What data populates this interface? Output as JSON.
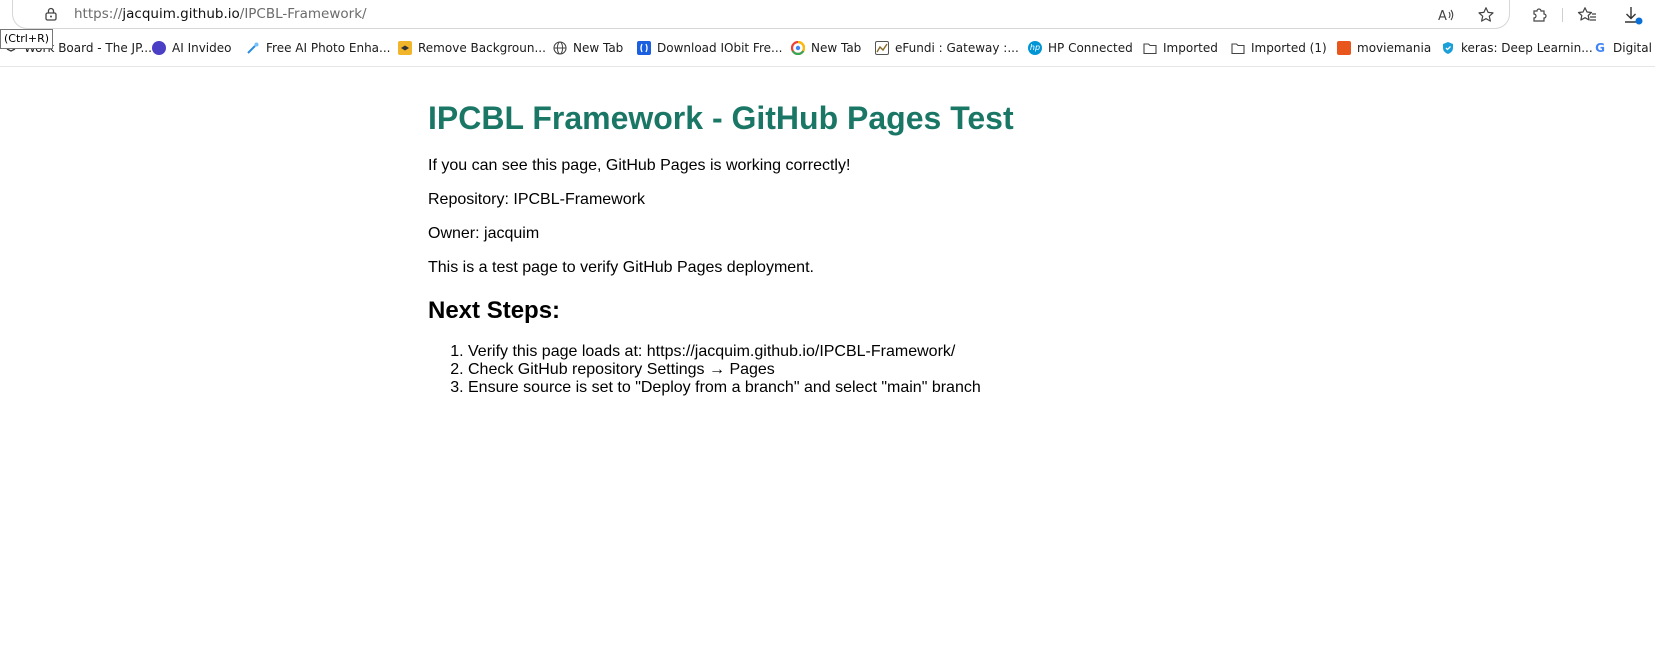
{
  "browser": {
    "url_scheme": "https://",
    "url_host": "jacquim.github.io",
    "url_path": "/IPCBL-Framework/",
    "tooltip": "(Ctrl+R)",
    "toolbar_icons": [
      "read-aloud-icon",
      "favorite-star-icon",
      "extensions-icon",
      "favorites-icon",
      "downloads-icon"
    ]
  },
  "bookmarks": [
    {
      "label": "Work Board - The JP...",
      "icon": "work-board-icon",
      "color": "#3a3a3a"
    },
    {
      "label": "AI Invideo",
      "icon": "invideo-icon",
      "color": "#4b3fc6"
    },
    {
      "label": "Free AI Photo Enha...",
      "icon": "photo-enhance-icon",
      "color": "#2a8be0"
    },
    {
      "label": "Remove Backgroun...",
      "icon": "remove-bg-icon",
      "color": "#f1b52c"
    },
    {
      "label": "New Tab",
      "icon": "globe-icon",
      "color": "#444444"
    },
    {
      "label": "Download IObit Fre...",
      "icon": "iobit-icon",
      "color": "#1a5fe0"
    },
    {
      "label": "New Tab",
      "icon": "chrome-icon",
      "color": "#34a853"
    },
    {
      "label": "eFundi : Gateway :...",
      "icon": "efundi-icon",
      "color": "#8a6a2a"
    },
    {
      "label": "HP Connected",
      "icon": "hp-icon",
      "color": "#0096d6"
    },
    {
      "label": "Imported",
      "icon": "folder-icon",
      "color": "#444444"
    },
    {
      "label": "Imported (1)",
      "icon": "folder-icon",
      "color": "#444444"
    },
    {
      "label": "moviemania",
      "icon": "moviemania-icon",
      "color": "#e8561e"
    },
    {
      "label": "keras: Deep Learnin...",
      "icon": "keras-shield-icon",
      "color": "#1aa0d8"
    },
    {
      "label": "Digital S",
      "icon": "google-icon",
      "color": "#4285f4"
    }
  ],
  "page": {
    "title": "IPCBL Framework - GitHub Pages Test",
    "paragraphs": [
      "If you can see this page, GitHub Pages is working correctly!",
      "Repository: IPCBL-Framework",
      "Owner: jacquim",
      "This is a test page to verify GitHub Pages deployment."
    ],
    "next_steps_heading": "Next Steps:",
    "steps": [
      "Verify this page loads at: https://jacquim.github.io/IPCBL-Framework/",
      "Check GitHub repository Settings → Pages",
      "Ensure source is set to \"Deploy from a branch\" and select \"main\" branch"
    ],
    "title_color": "#1a7766"
  }
}
